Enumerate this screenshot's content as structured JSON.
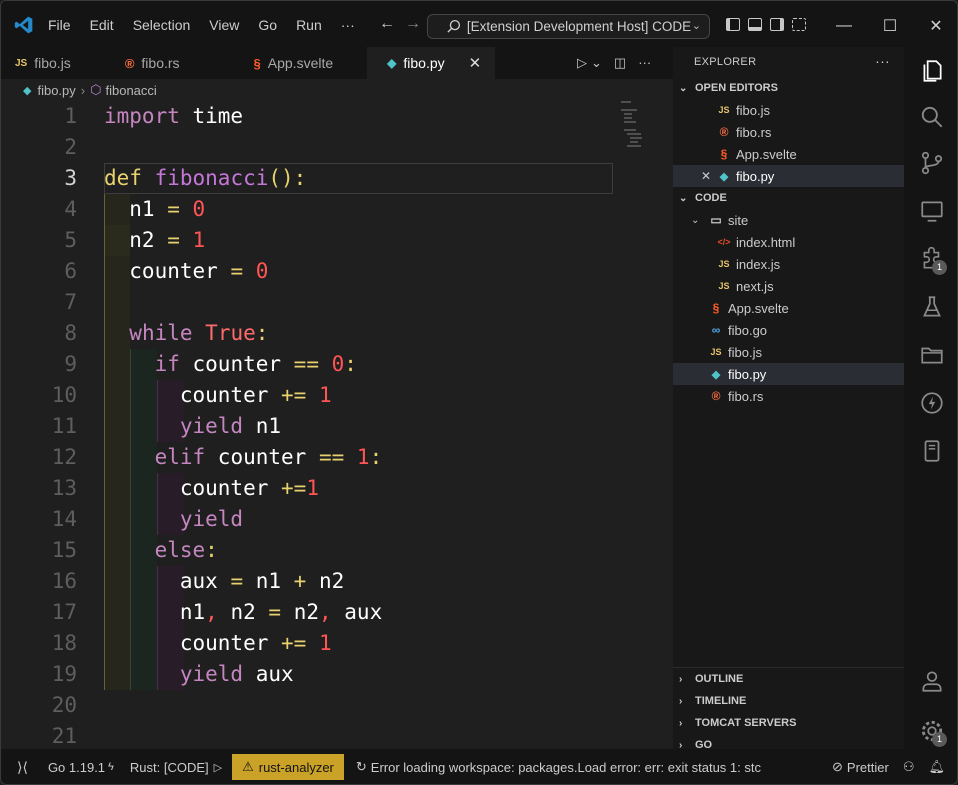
{
  "menu": [
    "File",
    "Edit",
    "Selection",
    "View",
    "Go",
    "Run",
    "···"
  ],
  "search": {
    "text": "[Extension Development Host] CODE"
  },
  "tabs": [
    {
      "icon": "JS",
      "label": "fibo.js",
      "color": "#e8c36a"
    },
    {
      "icon": "®",
      "label": "fibo.rs",
      "color": "#ff7043"
    },
    {
      "icon": "§",
      "label": "App.svelte",
      "color": "#ff5d2a"
    },
    {
      "icon": "◆",
      "label": "fibo.py",
      "color": "#4fc3c7",
      "active": true
    }
  ],
  "breadcrumb": {
    "file": "fibo.py",
    "symbol": "fibonacci"
  },
  "line_numbers": [
    "1",
    "2",
    "3",
    "4",
    "5",
    "6",
    "7",
    "8",
    "9",
    "10",
    "11",
    "12",
    "13",
    "14",
    "15",
    "16",
    "17",
    "18",
    "19",
    "20",
    "21"
  ],
  "explorer": {
    "title": "EXPLORER",
    "open_editors_title": "OPEN EDITORS",
    "open_editors": [
      {
        "icon": "JS",
        "label": "fibo.js",
        "color": "#e8c36a"
      },
      {
        "icon": "®",
        "label": "fibo.rs",
        "color": "#ff7043"
      },
      {
        "icon": "§",
        "label": "App.svelte",
        "color": "#ff5d2a"
      },
      {
        "icon": "◆",
        "label": "fibo.py",
        "color": "#4fc3c7"
      }
    ],
    "code_title": "CODE",
    "folder": "site",
    "folder_files": [
      {
        "icon": "</>",
        "label": "index.html",
        "color": "#e44d26"
      },
      {
        "icon": "JS",
        "label": "index.js",
        "color": "#e8c36a"
      },
      {
        "icon": "JS",
        "label": "next.js",
        "color": "#e8c36a"
      }
    ],
    "root_files": [
      {
        "icon": "§",
        "label": "App.svelte",
        "color": "#ff5d2a"
      },
      {
        "icon": "∞",
        "label": "fibo.go",
        "color": "#4fa6e8"
      },
      {
        "icon": "JS",
        "label": "fibo.js",
        "color": "#e8c36a"
      },
      {
        "icon": "◆",
        "label": "fibo.py",
        "color": "#4fc3c7"
      },
      {
        "icon": "®",
        "label": "fibo.rs",
        "color": "#ff7043"
      }
    ],
    "bottom_sections": [
      "OUTLINE",
      "TIMELINE",
      "TOMCAT SERVERS",
      "GO"
    ]
  },
  "activity_badges": {
    "extensions": "1",
    "settings": "1"
  },
  "status": {
    "go": "Go 1.19.1",
    "rust": "Rust: [CODE]",
    "analyzer": "rust-analyzer",
    "message": "Error loading workspace: packages.Load error: err: exit status 1: stc",
    "prettier": "Prettier"
  },
  "colors": {
    "accent": "#0078d4",
    "warning_bg": "#c9a227"
  }
}
